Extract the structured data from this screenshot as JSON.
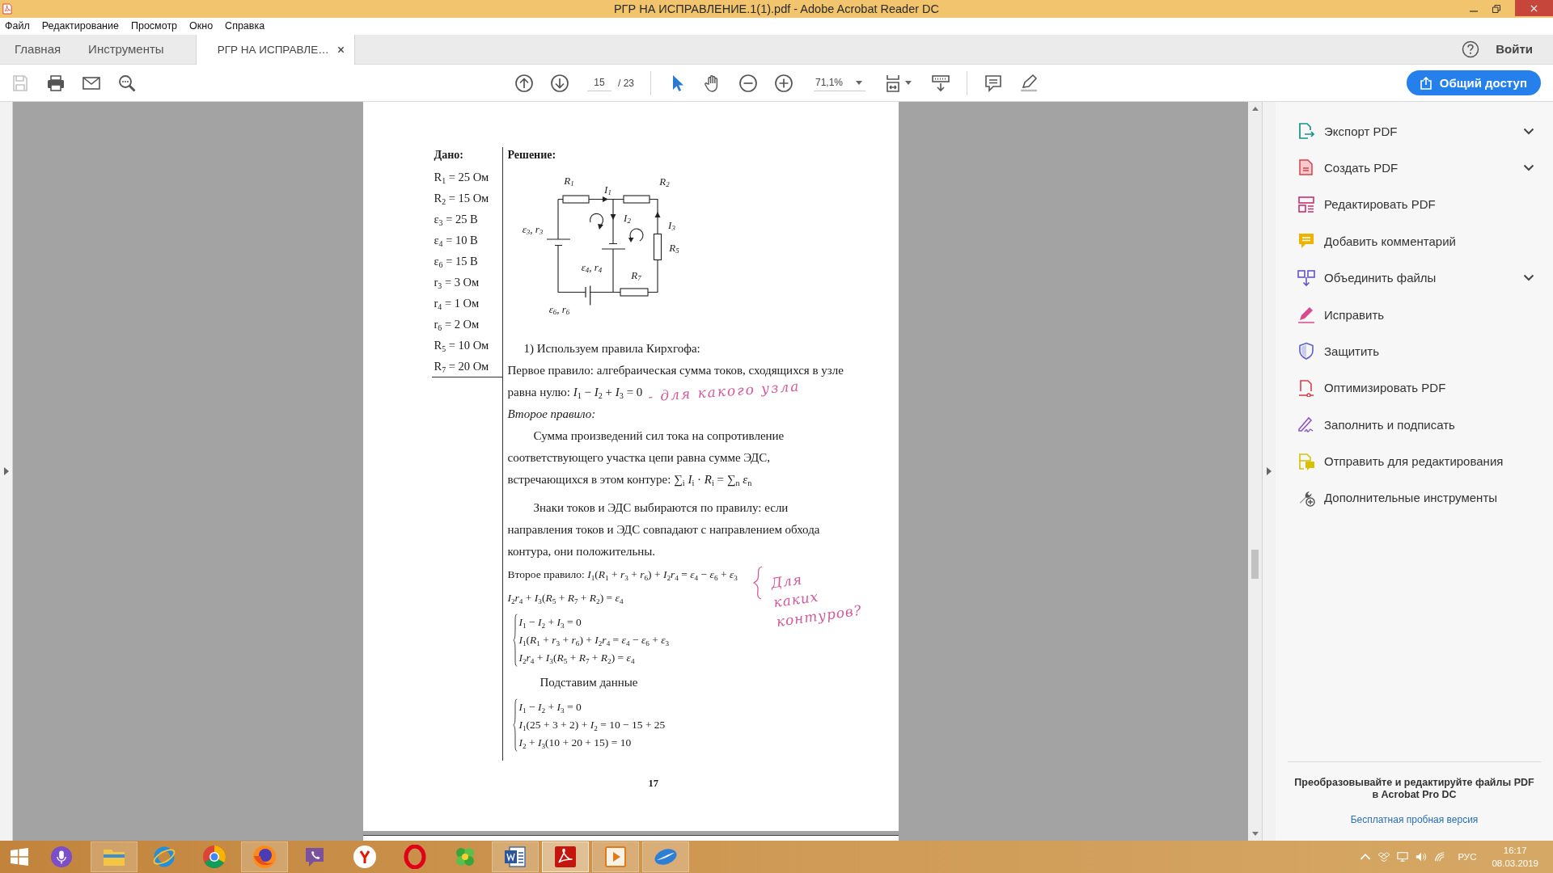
{
  "window": {
    "title": "РГР НА ИСПРАВЛЕНИЕ.1(1).pdf - Adobe Acrobat Reader DC"
  },
  "menu": [
    "Файл",
    "Редактирование",
    "Просмотр",
    "Окно",
    "Справка"
  ],
  "tabs": [
    {
      "label": "Главная",
      "selected": false,
      "closable": false
    },
    {
      "label": "Инструменты",
      "selected": false,
      "closable": false
    },
    {
      "label": "РГР НА ИСПРАВЛЕ…",
      "selected": true,
      "closable": true
    }
  ],
  "account": {
    "sign_in": "Войти"
  },
  "toolbar": {
    "save": {
      "disabled": true
    },
    "page_field": {
      "value": "15"
    },
    "page_total": "/ 23",
    "tools": [
      {
        "selected": true
      },
      {
        "selected": false
      }
    ],
    "zoom_field": {
      "value": "71,1%"
    },
    "share_button": "Общий доступ"
  },
  "document": {
    "given": {
      "title": "Дано:",
      "items": [
        "R$_{1}$ = 25 Ом",
        "R$_{2}$ = 15 Ом",
        "ε$_{3}$ = 25 В",
        "ε$_{4}$ = 10 В",
        "ε$_{6}$ = 15 В",
        "r$_{3}$ = 3 Ом",
        "r$_{4}$ = 1 Ом",
        "r$_{6}$ = 2 Ом",
        "R$_{5}$ = 10 Ом",
        "R$_{7}$ = 20 Ом"
      ]
    },
    "solution": {
      "title": "Решение:",
      "circuit": {
        "labels": [
          "R$_{1}$",
          "I$_{1}$",
          "R$_{2}$",
          "ε$_{3}$, r$_{3}$",
          "I$_{2}$",
          "I$_{3}$",
          "R$_{5}$",
          "ε$_{4}$, r$_{4}$",
          "R$_{7}$",
          "ε$_{6}$, r$_{6}$"
        ]
      },
      "blocks": [
        {
          "kind": "step",
          "text": "1) Используем правила Кирхгофа:"
        },
        {
          "kind": "text",
          "text": "Первое правило: алгебраическая сумма токов, сходящихся в узле"
        },
        {
          "kind": "text",
          "text": "равна нулю: *I*$_{1}$ − *I*$_{2}$ + *I*$_{3}$ = 0",
          "note": {
            "kind": "inline",
            "text": "- для какого узла"
          }
        },
        {
          "kind": "subheading",
          "text": "Второе правило:"
        },
        {
          "kind": "paragraph",
          "text": "Сумма произведений сил тока на сопротивление\nсоответствующего участка цепи равна сумме ЭДС,\nвстречающихся в этом контуре: ∑$_{i}$ *I*$_{i}$ · *R*$_{i}$ = ∑$_{n}$ *ε*$_{n}$"
        },
        {
          "kind": "paragraph",
          "text": "Знаки токов и ЭДС выбираются по правилу: если\nнаправления токов и ЭДС совпадают с направлением обхода\nконтура, они положительны."
        },
        {
          "kind": "formula",
          "text": "Второе правило: *I*$_{1}$(*R*$_{1}$ + *r*$_{3}$ + *r*$_{6}$) + *I*$_{2}$*r*$_{4}$ = *ε*$_{4}$ − *ε*$_{6}$ + *ε*$_{3}$",
          "note": {
            "kind": "brace",
            "text": "Для\nкаких\nконтуров?"
          }
        },
        {
          "kind": "formula",
          "text": "*I*$_{2}$*r*$_{4}$ + *I*$_{3}$(*R*$_{5}$ + *R*$_{7}$ + *R*$_{2}$) = *ε*$_{4}$"
        },
        {
          "kind": "system",
          "lines": [
            "*I*$_{1}$ − *I*$_{2}$ + *I*$_{3}$ = 0",
            "*I*$_{1}$(*R*$_{1}$ + *r*$_{3}$ + *r*$_{6}$) + *I*$_{2}$*r*$_{4}$ = *ε*$_{4}$ − *ε*$_{6}$ + *ε*$_{3}$",
            "*I*$_{2}$*r*$_{4}$ + *I*$_{3}$(*R*$_{5}$ + *R*$_{7}$ + *R*$_{2}$) = *ε*$_{4}$"
          ]
        },
        {
          "kind": "caption",
          "text": "Подставим данные"
        },
        {
          "kind": "system",
          "lines": [
            "*I*$_{1}$ − *I*$_{2}$ + *I*$_{3}$ = 0",
            "*I*$_{1}$(25 + 3 + 2) + *I*$_{2}$ = 10 − 15 + 25",
            "*I*$_{2}$ + *I*$_{3}$(10 + 20 + 15) = 10"
          ]
        }
      ]
    },
    "page_number": "17"
  },
  "tools_panel": {
    "items": [
      {
        "label": "Экспорт PDF",
        "expandable": true
      },
      {
        "label": "Создать PDF",
        "expandable": true
      },
      {
        "label": "Редактировать PDF",
        "expandable": false
      },
      {
        "label": "Добавить комментарий",
        "expandable": false
      },
      {
        "label": "Объединить файлы",
        "expandable": true
      },
      {
        "label": "Исправить",
        "expandable": false
      },
      {
        "label": "Защитить",
        "expandable": false
      },
      {
        "label": "Оптимизировать PDF",
        "expandable": false
      },
      {
        "label": "Заполнить и подписать",
        "expandable": false
      },
      {
        "label": "Отправить для редактирования",
        "expandable": false
      },
      {
        "label": "Дополнительные инструменты",
        "expandable": false
      }
    ],
    "promo": {
      "text": "Преобразовывайте и редактируйте файлы PDF\nв Acrobat Pro DC",
      "link": "Бесплатная пробная версия"
    }
  },
  "taskbar": {
    "apps": [
      {
        "running": true,
        "selected": false
      },
      {
        "running": false,
        "selected": false
      },
      {
        "running": false,
        "selected": false
      },
      {
        "running": true,
        "selected": false
      },
      {
        "running": false,
        "selected": false
      },
      {
        "running": false,
        "selected": false
      },
      {
        "running": false,
        "selected": false
      },
      {
        "running": false,
        "selected": false
      },
      {
        "running": true,
        "selected": false
      },
      {
        "running": true,
        "selected": true
      },
      {
        "running": true,
        "selected": false
      },
      {
        "running": true,
        "selected": false
      }
    ],
    "language": "РУС",
    "time": "16:17",
    "date": "08.03.2019"
  }
}
